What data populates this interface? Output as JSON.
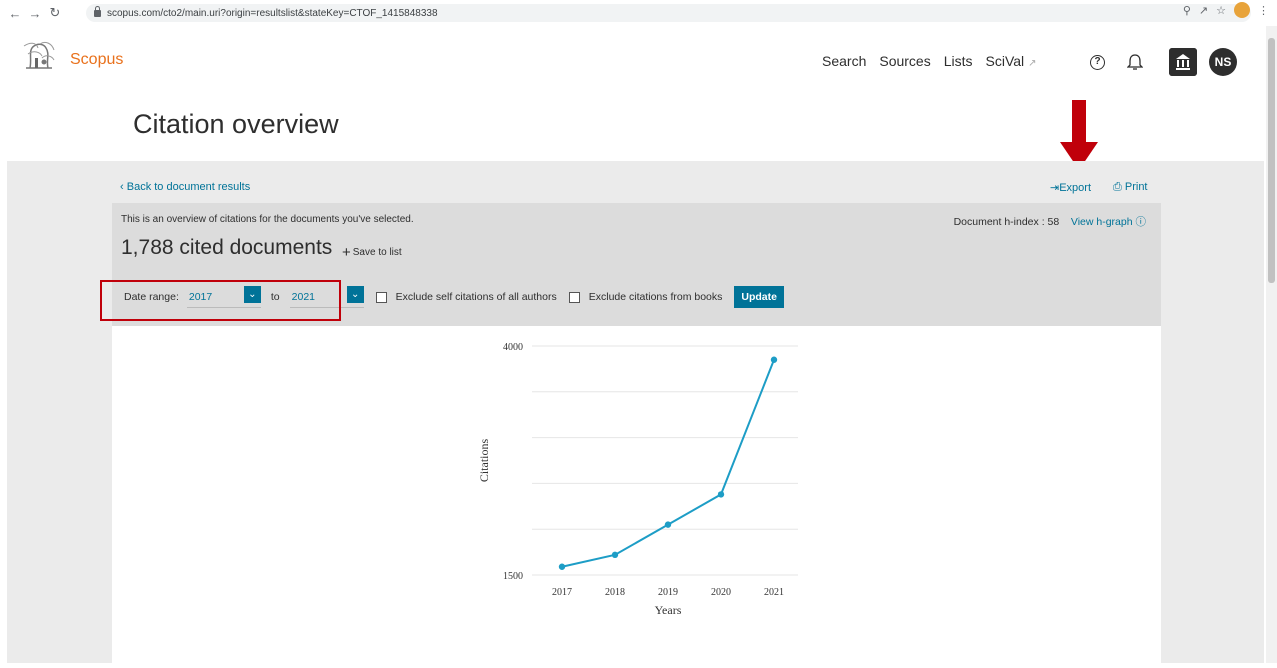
{
  "browser": {
    "url": "scopus.com/cto2/main.uri?origin=resultslist&stateKey=CTOF_1415848338"
  },
  "header": {
    "brand": "Scopus",
    "nav": [
      "Search",
      "Sources",
      "Lists",
      "SciVal"
    ],
    "help_icon": "?",
    "user_initials": "NS"
  },
  "page": {
    "title": "Citation overview",
    "back_link": "Back to document results",
    "export_label": "Export",
    "print_label": "Print"
  },
  "summary": {
    "intro": "This is an overview of citations for the documents you've selected.",
    "hindex_label": "Document h-index : 58",
    "view_hgraph": "View h-graph",
    "cited_count": "1,788 cited documents",
    "save_to_list": "Save to list"
  },
  "filters": {
    "date_range_label": "Date range:",
    "from_year": "2017",
    "to_label": "to",
    "to_year": "2021",
    "exclude_self": "Exclude self citations of all authors",
    "exclude_books": "Exclude citations from books",
    "update_label": "Update"
  },
  "chart_data": {
    "type": "line",
    "x": [
      "2017",
      "2018",
      "2019",
      "2020",
      "2021"
    ],
    "values": [
      1590,
      1720,
      2050,
      2380,
      3850
    ],
    "xlabel": "Years",
    "ylabel": "Citations",
    "ylim": [
      1500,
      4000
    ],
    "y_tick_labels": [
      "1500",
      "4000"
    ],
    "grid": true,
    "color": "#1d9dc6"
  },
  "colors": {
    "brand_orange": "#e9711c",
    "link_blue": "#007398",
    "highlight_red": "#c0000a"
  }
}
